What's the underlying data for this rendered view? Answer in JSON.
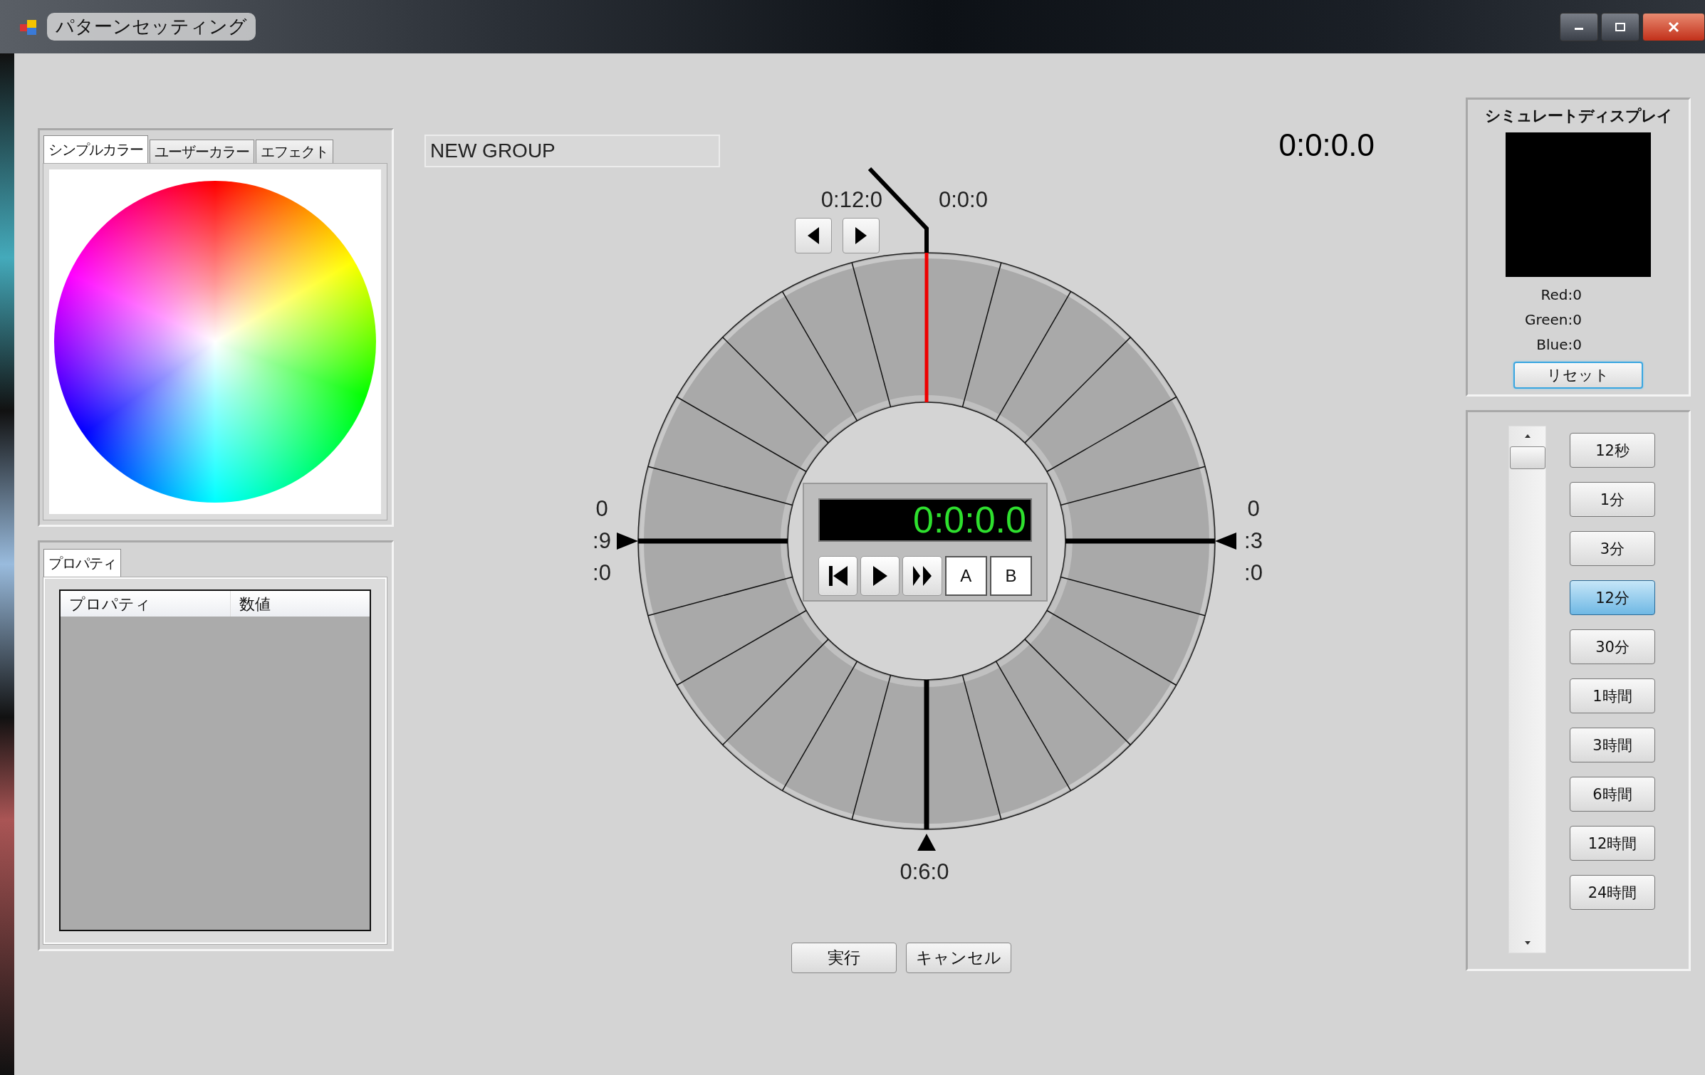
{
  "window": {
    "title": "パターンセッティング"
  },
  "color_tabs": [
    {
      "label": "シンプルカラー",
      "selected": true
    },
    {
      "label": "ユーザーカラー",
      "selected": false
    },
    {
      "label": "エフェクト",
      "selected": false
    }
  ],
  "property_tabs": [
    {
      "label": "プロパティ",
      "selected": true
    }
  ],
  "property_table": {
    "columns": [
      "プロパティ",
      "数値"
    ]
  },
  "group_name": {
    "value": "NEW GROUP"
  },
  "elapsed_time": "0:0:0.0",
  "dial": {
    "top_left_label": "0:12:0",
    "top_right_label": "0:0:0",
    "left_label": [
      "0",
      ":9",
      ":0"
    ],
    "right_label": [
      "0",
      ":3",
      ":0"
    ],
    "bottom_label": "0:6:0"
  },
  "player": {
    "display": "0:0:0.0",
    "buttons": [
      {
        "kind": "skip-start"
      },
      {
        "kind": "play"
      },
      {
        "kind": "fast-forward"
      },
      {
        "kind": "text",
        "label": "A"
      },
      {
        "kind": "text",
        "label": "B"
      }
    ]
  },
  "simulate_display": {
    "title": "シミュレートディスプレイ",
    "readings": [
      "Red:0",
      "Green:0",
      "Blue:0"
    ],
    "reset_button": {
      "label": "リセット",
      "focused": true
    }
  },
  "time_scales": [
    {
      "label": "12秒",
      "selected": false
    },
    {
      "label": "1分",
      "selected": false
    },
    {
      "label": "3分",
      "selected": false
    },
    {
      "label": "12分",
      "selected": true
    },
    {
      "label": "30分",
      "selected": false
    },
    {
      "label": "1時間",
      "selected": false
    },
    {
      "label": "3時間",
      "selected": false
    },
    {
      "label": "6時間",
      "selected": false
    },
    {
      "label": "12時間",
      "selected": false
    },
    {
      "label": "24時間",
      "selected": false
    }
  ],
  "actions": [
    "実行",
    "キャンセル"
  ]
}
